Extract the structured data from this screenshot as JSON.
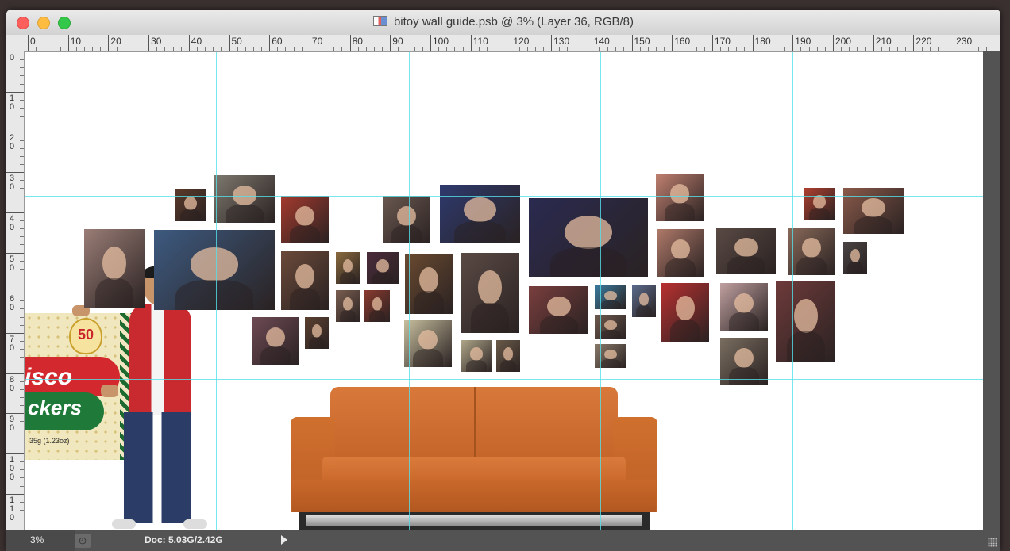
{
  "window": {
    "title": "bitoy wall guide.psb @ 3% (Layer 36, RGB/8)"
  },
  "ruler": {
    "horizontal_labels": [
      "0",
      "10",
      "20",
      "30",
      "40",
      "50",
      "60",
      "70",
      "80",
      "90",
      "100",
      "110",
      "120",
      "130",
      "140",
      "150",
      "160",
      "170",
      "180",
      "190",
      "200",
      "210",
      "220",
      "230"
    ],
    "vertical_labels": [
      "0",
      "10",
      "20",
      "30",
      "40",
      "50",
      "60",
      "70",
      "80",
      "90",
      "100",
      "110"
    ]
  },
  "canvas": {
    "background": "#ffffff",
    "guide_color": "#55e0ea",
    "product": {
      "brand_line1": "isco",
      "brand_line2": "ckers",
      "badge": "50",
      "weight": "35g (1.23oz)"
    }
  },
  "photos": [
    {
      "color": "#5a3a2a"
    },
    {
      "color": "#7d786e"
    },
    {
      "color": "#a43a2e"
    },
    {
      "color": "#9a7d76"
    },
    {
      "color": "#3d5a80"
    },
    {
      "color": "#6b4a3a"
    },
    {
      "color": "#8a6a3e"
    },
    {
      "color": "#4b2b3b"
    },
    {
      "color": "#6e4a55"
    },
    {
      "color": "#5a4030"
    },
    {
      "color": "#7a5e50"
    },
    {
      "color": "#8a3a2e"
    },
    {
      "color": "#6a5850"
    },
    {
      "color": "#2e3a6e"
    },
    {
      "color": "#6a4a30"
    },
    {
      "color": "#5a4a44"
    },
    {
      "color": "#c9c0a0"
    },
    {
      "color": "#b0a78a"
    },
    {
      "color": "#6a5a48"
    },
    {
      "color": "#2a2a50"
    },
    {
      "color": "#7a3e3e"
    },
    {
      "color": "#3a7a9e"
    },
    {
      "color": "#6e5a4e"
    },
    {
      "color": "#8a7a6a"
    },
    {
      "color": "#5a6a8a"
    },
    {
      "color": "#c08070"
    },
    {
      "color": "#b07a6a"
    },
    {
      "color": "#b83030"
    },
    {
      "color": "#5a4a44"
    },
    {
      "color": "#c0a0a0"
    },
    {
      "color": "#7a6e60"
    },
    {
      "color": "#6e3a3a"
    },
    {
      "color": "#8a6a5a"
    },
    {
      "color": "#b04030"
    },
    {
      "color": "#8a5a4a"
    },
    {
      "color": "#4a4444"
    }
  ],
  "status": {
    "zoom": "3%",
    "doc_info": "Doc: 5.03G/2.42G"
  }
}
